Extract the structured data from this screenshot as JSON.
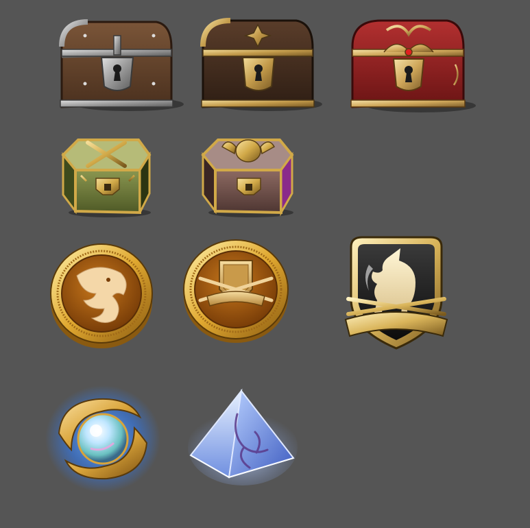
{
  "sheet": {
    "background": "#555555",
    "rows": [
      {
        "name": "chests",
        "items": [
          {
            "icon": "wooden-chest-icon",
            "tier": "iron",
            "colors": {
              "wood": "#6b4a33",
              "metal": "#a6a6a6"
            }
          },
          {
            "icon": "dark-gold-chest-icon",
            "tier": "gold",
            "colors": {
              "wood": "#4a3324",
              "metal": "#c9a85a"
            }
          },
          {
            "icon": "red-royal-chest-icon",
            "tier": "royal",
            "colors": {
              "wood": "#8c1f1f",
              "metal": "#d9b870"
            }
          }
        ]
      },
      {
        "name": "hex-boxes",
        "items": [
          {
            "icon": "green-swords-hex-box-icon",
            "colors": {
              "body": "#6e7a3a",
              "metal": "#d1a948"
            }
          },
          {
            "icon": "purple-armor-hex-box-icon",
            "colors": {
              "body": "#7a5a56",
              "accent": "#8a2a8a",
              "metal": "#d1a948"
            }
          }
        ]
      },
      {
        "name": "emblems",
        "items": [
          {
            "icon": "dragon-coin-icon",
            "colors": {
              "rim": "#d49a2a",
              "face": "#a05a0e",
              "emblem": "#f4d7a8"
            }
          },
          {
            "icon": "shield-coin-icon",
            "colors": {
              "rim": "#d49a2a",
              "face": "#a05a0e",
              "emblem": "#e8c07a"
            }
          },
          {
            "icon": "unicorn-crest-icon",
            "colors": {
              "frame": "#d9b45a",
              "field": "#1a1a1a",
              "emblem": "#f0e0b0"
            }
          }
        ]
      },
      {
        "name": "orbs",
        "items": [
          {
            "icon": "glowing-orb-relic-icon",
            "colors": {
              "glow": "#2f7fff",
              "gold": "#d9a43a",
              "core": "#d8f2ff"
            }
          },
          {
            "icon": "crystal-pyramid-icon",
            "colors": {
              "glow": "#7fa8ff",
              "face": "#9ec4ff",
              "rune": "#5a3a8a"
            }
          }
        ]
      }
    ]
  }
}
